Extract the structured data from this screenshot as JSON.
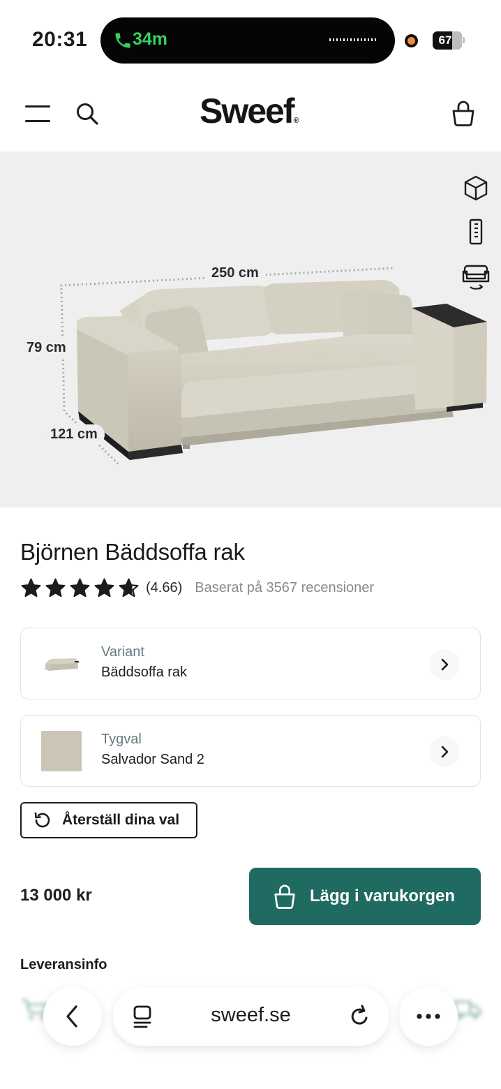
{
  "status_bar": {
    "time": "20:31",
    "call_duration": "34m",
    "battery_percent": "67",
    "battery_level": 0.67
  },
  "header": {
    "logo_text": "Sweef",
    "logo_mark": "®",
    "icons": [
      "menu-icon",
      "search-icon",
      "shopping-bag-icon"
    ]
  },
  "product_image": {
    "dimensions": {
      "width": "250 cm",
      "height": "79 cm",
      "depth": "121 cm"
    },
    "tools": [
      "3d-view-icon",
      "measure-icon",
      "ar-sofa-icon"
    ]
  },
  "product": {
    "title": "Björnen Bäddsoffa rak",
    "rating": "(4.66)",
    "rating_value": 4.66,
    "review_text": "Baserat på 3567 recensioner",
    "variant": {
      "label": "Variant",
      "value": "Bäddsoffa rak"
    },
    "fabric": {
      "label": "Tygval",
      "value": "Salvador Sand 2",
      "swatch_color": "#cbc5b7"
    },
    "reset_label": "Återställ dina val",
    "price": "13 000 kr",
    "add_to_cart_label": "Lägg i varukorgen",
    "delivery_heading": "Leveransinfo"
  },
  "browser": {
    "url": "sweef.se"
  },
  "colors": {
    "accent": "#1f6b62",
    "image_background": "#efefef",
    "call_green": "#36d160",
    "muted_label": "#667a80"
  }
}
